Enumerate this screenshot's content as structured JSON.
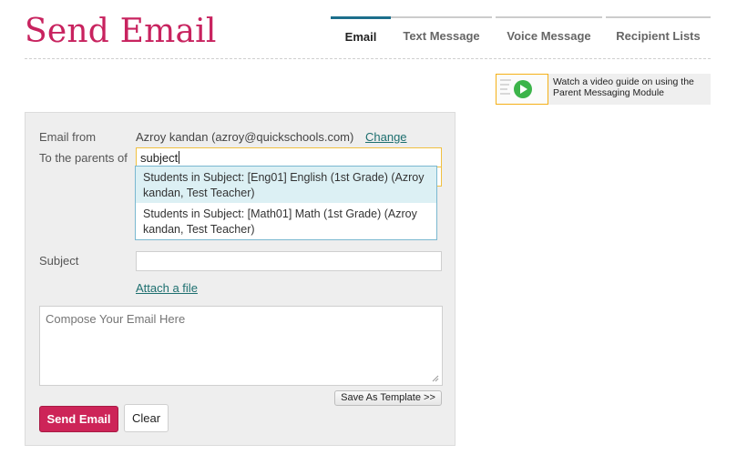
{
  "page": {
    "title": "Send Email"
  },
  "tabs": [
    {
      "label": "Email",
      "active": true
    },
    {
      "label": "Text Message",
      "active": false
    },
    {
      "label": "Voice Message",
      "active": false
    },
    {
      "label": "Recipient Lists",
      "active": false
    }
  ],
  "video_guide": {
    "text": "Watch a video guide on using the Parent Messaging Module",
    "icon": "play-icon"
  },
  "form": {
    "email_from_label": "Email from",
    "email_from_value": "Azroy kandan (azroy@quickschools.com)",
    "change_link": "Change",
    "to_label": "To the parents of",
    "to_value": "subject",
    "suggestions": [
      "Students in Subject: [Eng01] English (1st Grade) (Azroy kandan, Test Teacher)",
      "Students in Subject: [Math01] Math (1st Grade) (Azroy kandan, Test Teacher)"
    ],
    "subject_label": "Subject",
    "subject_value": "",
    "attach_link": "Attach a file",
    "compose_placeholder": "Compose Your Email Here",
    "save_template_label": "Save As Template >>",
    "send_label": "Send Email",
    "clear_label": "Clear"
  },
  "colors": {
    "brand": "#c8235f",
    "tab_active": "#1d6f8c",
    "link": "#1d6f6f",
    "input_focus": "#f0c040",
    "suggestion_highlight": "#dcf0f4"
  }
}
